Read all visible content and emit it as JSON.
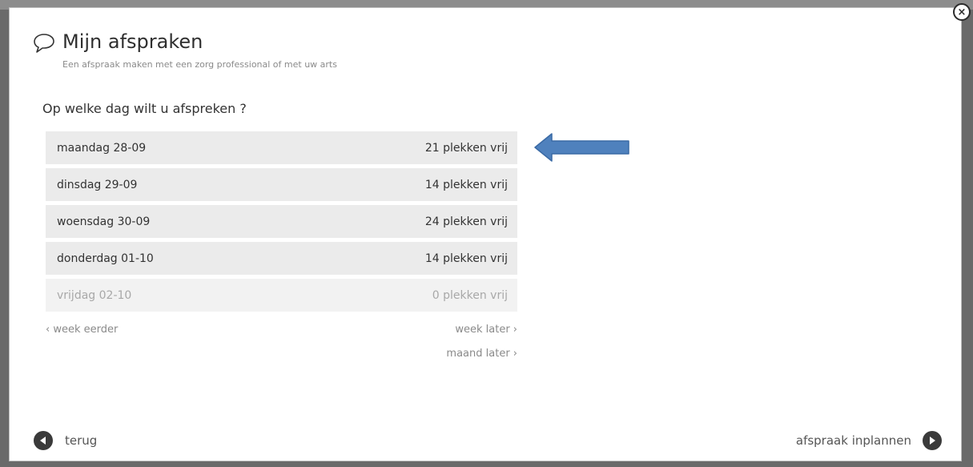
{
  "dialog": {
    "title": "Mijn afspraken",
    "subtitle": "Een afspraak maken met een zorg professional of met uw arts",
    "question": "Op welke dag wilt u afspreken ?",
    "close_label": "×"
  },
  "days": [
    {
      "day": "maandag 28-09",
      "slots": "21 plekken vrij"
    },
    {
      "day": "dinsdag 29-09",
      "slots": "14 plekken vrij"
    },
    {
      "day": "woensdag 30-09",
      "slots": "24 plekken vrij"
    },
    {
      "day": "donderdag 01-10",
      "slots": "14 plekken vrij"
    },
    {
      "day": "vrijdag 02-10",
      "slots": "0 plekken vrij"
    }
  ],
  "navigation": {
    "week_earlier": "‹ week eerder",
    "week_later": "week later ›",
    "month_later": "maand later ›"
  },
  "footer": {
    "back_label": "terug",
    "next_label": "afspraak inplannen"
  },
  "colors": {
    "arrow": "#4f81bd",
    "row_bg": "#ebebeb",
    "row_disabled_bg": "#f2f2f2",
    "dark_button": "#3a3a3a"
  },
  "icons": {
    "header": "chat-bubble-icon",
    "close": "close-icon",
    "back": "arrow-left-circle-icon",
    "next": "arrow-right-circle-icon",
    "annotation": "left-arrow-annotation"
  }
}
